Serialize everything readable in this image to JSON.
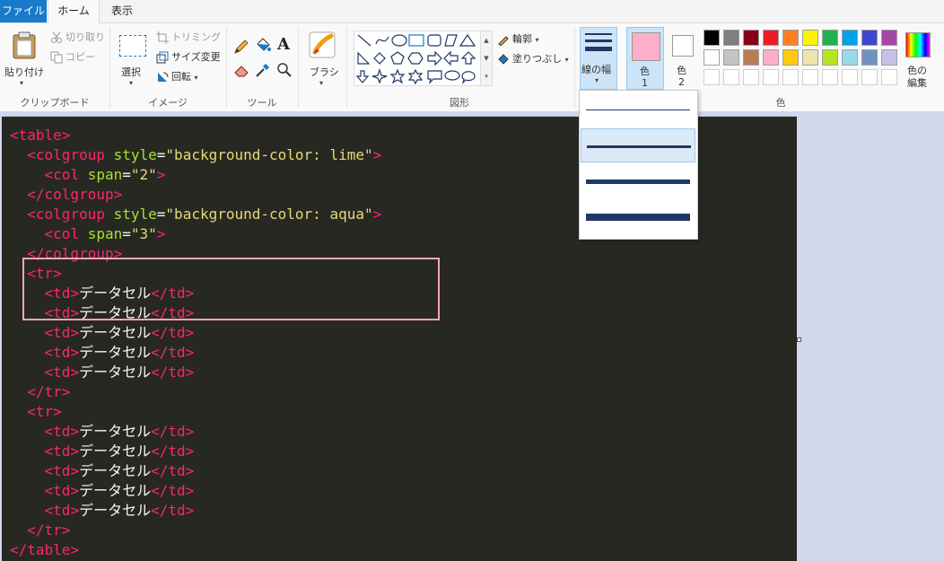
{
  "tabs": {
    "file": "ファイル",
    "home": "ホーム",
    "view": "表示"
  },
  "clipboard": {
    "paste": "貼り付け",
    "cut": "切り取り",
    "copy": "コピー",
    "label": "クリップボード"
  },
  "image": {
    "select": "選択",
    "crop": "トリミング",
    "resize": "サイズ変更",
    "rotate": "回転",
    "label": "イメージ"
  },
  "tools": {
    "text_icon": "A",
    "label": "ツール"
  },
  "brush": {
    "label": "ブラシ"
  },
  "shapes": {
    "outline": "輪郭",
    "fill": "塗りつぶし",
    "label": "図形"
  },
  "line_width": {
    "label": "線の幅"
  },
  "colors": {
    "color1_label": "色",
    "color1_num": "1",
    "color2_label": "色",
    "color2_num": "2",
    "edit": "色の",
    "edit2": "編集",
    "group_label": "色",
    "color1": "#ffaec9",
    "color2": "#ffffff",
    "palette_row1": [
      "#000000",
      "#7f7f7f",
      "#880015",
      "#ed1c24",
      "#ff7f27",
      "#fff200",
      "#22b14c",
      "#00a2e8",
      "#3f48cc",
      "#a349a4"
    ],
    "palette_row2": [
      "#ffffff",
      "#c3c3c3",
      "#b97a57",
      "#ffaec9",
      "#ffc90e",
      "#efe4b0",
      "#b5e61d",
      "#99d9ea",
      "#7092be",
      "#c8bfe7"
    ],
    "palette_row3": [
      "#ffffff",
      "#ffffff",
      "#ffffff",
      "#ffffff",
      "#ffffff",
      "#ffffff",
      "#ffffff",
      "#ffffff",
      "#ffffff",
      "#ffffff"
    ]
  },
  "line_width_options": [
    1,
    3,
    5,
    8
  ],
  "line_width_selected_index": 1,
  "code_lines": [
    [
      [
        "t",
        "<"
      ],
      [
        "t",
        "table"
      ],
      [
        "t",
        ">"
      ]
    ],
    [
      [
        "p",
        "  "
      ],
      [
        "t",
        "<"
      ],
      [
        "t",
        "colgroup"
      ],
      [
        "p",
        " "
      ],
      [
        "a",
        "style"
      ],
      [
        "p",
        "="
      ],
      [
        "s",
        "\"background-color: lime\""
      ],
      [
        "t",
        ">"
      ]
    ],
    [
      [
        "p",
        "    "
      ],
      [
        "t",
        "<"
      ],
      [
        "t",
        "col"
      ],
      [
        "p",
        " "
      ],
      [
        "a",
        "span"
      ],
      [
        "p",
        "="
      ],
      [
        "s",
        "\"2\""
      ],
      [
        "t",
        ">"
      ]
    ],
    [
      [
        "p",
        "  "
      ],
      [
        "t",
        "</"
      ],
      [
        "t",
        "colgroup"
      ],
      [
        "t",
        ">"
      ]
    ],
    [
      [
        "p",
        "  "
      ],
      [
        "t",
        "<"
      ],
      [
        "t",
        "colgroup"
      ],
      [
        "p",
        " "
      ],
      [
        "a",
        "style"
      ],
      [
        "p",
        "="
      ],
      [
        "s",
        "\"background-color: aqua\""
      ],
      [
        "t",
        ">"
      ]
    ],
    [
      [
        "p",
        "    "
      ],
      [
        "t",
        "<"
      ],
      [
        "t",
        "col"
      ],
      [
        "p",
        " "
      ],
      [
        "a",
        "span"
      ],
      [
        "p",
        "="
      ],
      [
        "s",
        "\"3\""
      ],
      [
        "t",
        ">"
      ]
    ],
    [
      [
        "p",
        "  "
      ],
      [
        "t",
        "</"
      ],
      [
        "t",
        "colgroup"
      ],
      [
        "t",
        ">"
      ]
    ],
    [
      [
        "p",
        "  "
      ],
      [
        "t",
        "<"
      ],
      [
        "t",
        "tr"
      ],
      [
        "t",
        ">"
      ]
    ],
    [
      [
        "p",
        "    "
      ],
      [
        "t",
        "<"
      ],
      [
        "t",
        "td"
      ],
      [
        "t",
        ">"
      ],
      [
        "p",
        "データセル"
      ],
      [
        "t",
        "</"
      ],
      [
        "t",
        "td"
      ],
      [
        "t",
        ">"
      ]
    ],
    [
      [
        "p",
        "    "
      ],
      [
        "t",
        "<"
      ],
      [
        "t",
        "td"
      ],
      [
        "t",
        ">"
      ],
      [
        "p",
        "データセル"
      ],
      [
        "t",
        "</"
      ],
      [
        "t",
        "td"
      ],
      [
        "t",
        ">"
      ]
    ],
    [
      [
        "p",
        "    "
      ],
      [
        "t",
        "<"
      ],
      [
        "t",
        "td"
      ],
      [
        "t",
        ">"
      ],
      [
        "p",
        "データセル"
      ],
      [
        "t",
        "</"
      ],
      [
        "t",
        "td"
      ],
      [
        "t",
        ">"
      ]
    ],
    [
      [
        "p",
        "    "
      ],
      [
        "t",
        "<"
      ],
      [
        "t",
        "td"
      ],
      [
        "t",
        ">"
      ],
      [
        "p",
        "データセル"
      ],
      [
        "t",
        "</"
      ],
      [
        "t",
        "td"
      ],
      [
        "t",
        ">"
      ]
    ],
    [
      [
        "p",
        "    "
      ],
      [
        "t",
        "<"
      ],
      [
        "t",
        "td"
      ],
      [
        "t",
        ">"
      ],
      [
        "p",
        "データセル"
      ],
      [
        "t",
        "</"
      ],
      [
        "t",
        "td"
      ],
      [
        "t",
        ">"
      ]
    ],
    [
      [
        "p",
        "  "
      ],
      [
        "t",
        "</"
      ],
      [
        "t",
        "tr"
      ],
      [
        "t",
        ">"
      ]
    ],
    [
      [
        "p",
        "  "
      ],
      [
        "t",
        "<"
      ],
      [
        "t",
        "tr"
      ],
      [
        "t",
        ">"
      ]
    ],
    [
      [
        "p",
        "    "
      ],
      [
        "t",
        "<"
      ],
      [
        "t",
        "td"
      ],
      [
        "t",
        ">"
      ],
      [
        "p",
        "データセル"
      ],
      [
        "t",
        "</"
      ],
      [
        "t",
        "td"
      ],
      [
        "t",
        ">"
      ]
    ],
    [
      [
        "p",
        "    "
      ],
      [
        "t",
        "<"
      ],
      [
        "t",
        "td"
      ],
      [
        "t",
        ">"
      ],
      [
        "p",
        "データセル"
      ],
      [
        "t",
        "</"
      ],
      [
        "t",
        "td"
      ],
      [
        "t",
        ">"
      ]
    ],
    [
      [
        "p",
        "    "
      ],
      [
        "t",
        "<"
      ],
      [
        "t",
        "td"
      ],
      [
        "t",
        ">"
      ],
      [
        "p",
        "データセル"
      ],
      [
        "t",
        "</"
      ],
      [
        "t",
        "td"
      ],
      [
        "t",
        ">"
      ]
    ],
    [
      [
        "p",
        "    "
      ],
      [
        "t",
        "<"
      ],
      [
        "t",
        "td"
      ],
      [
        "t",
        ">"
      ],
      [
        "p",
        "データセル"
      ],
      [
        "t",
        "</"
      ],
      [
        "t",
        "td"
      ],
      [
        "t",
        ">"
      ]
    ],
    [
      [
        "p",
        "    "
      ],
      [
        "t",
        "<"
      ],
      [
        "t",
        "td"
      ],
      [
        "t",
        ">"
      ],
      [
        "p",
        "データセル"
      ],
      [
        "t",
        "</"
      ],
      [
        "t",
        "td"
      ],
      [
        "t",
        ">"
      ]
    ],
    [
      [
        "p",
        "  "
      ],
      [
        "t",
        "</"
      ],
      [
        "t",
        "tr"
      ],
      [
        "t",
        ">"
      ]
    ],
    [
      [
        "t",
        "</"
      ],
      [
        "t",
        "table"
      ],
      [
        "t",
        ">"
      ]
    ]
  ]
}
